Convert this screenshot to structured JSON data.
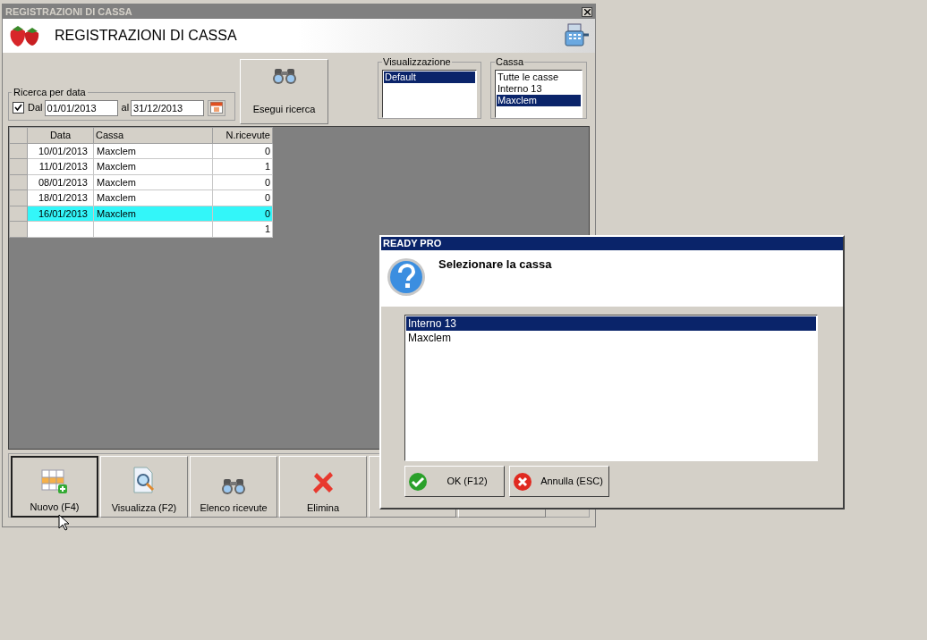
{
  "window": {
    "title": "REGISTRAZIONI DI CASSA",
    "header_title": "REGISTRAZIONI DI CASSA"
  },
  "search": {
    "group_label": "Ricerca per data",
    "checkbox": {
      "label": "Dal",
      "checked": true
    },
    "from": "01/01/2013",
    "to_label": "al",
    "to": "31/12/2013"
  },
  "search_button": "Esegui ricerca",
  "views": {
    "label": "Visualizzazione",
    "items": [
      {
        "label": "Default",
        "selected": true
      }
    ]
  },
  "registers": {
    "label": "Cassa",
    "items": [
      {
        "label": "Tutte le casse",
        "selected": false
      },
      {
        "label": "Interno 13",
        "selected": false
      },
      {
        "label": "Maxclem",
        "selected": true
      }
    ]
  },
  "table": {
    "columns": [
      "Data",
      "Cassa",
      "N.ricevute"
    ],
    "rows": [
      {
        "data": "10/01/2013",
        "cassa": "Maxclem",
        "n_ricevute": "0",
        "selected": false
      },
      {
        "data": "11/01/2013",
        "cassa": "Maxclem",
        "n_ricevute": "1",
        "selected": false
      },
      {
        "data": "08/01/2013",
        "cassa": "Maxclem",
        "n_ricevute": "0",
        "selected": false
      },
      {
        "data": "18/01/2013",
        "cassa": "Maxclem",
        "n_ricevute": "0",
        "selected": false
      },
      {
        "data": "16/01/2013",
        "cassa": "Maxclem",
        "n_ricevute": "0",
        "selected": true
      },
      {
        "n_ricevute": "1",
        "selected": false
      }
    ]
  },
  "buttons": [
    {
      "label": "Nuovo (F4)",
      "focused": true
    },
    {
      "label": "Visualizza (F2)",
      "focused": false
    },
    {
      "label": "Elenco ricevute",
      "focused": false
    },
    {
      "label": "Elimina",
      "focused": false
    },
    {
      "focused": false
    },
    {
      "focused": false
    }
  ],
  "dialog": {
    "title": "READY PRO",
    "message": "Selezionare la cassa",
    "items": [
      {
        "label": "Interno 13",
        "selected": true
      },
      {
        "label": "Maxclem",
        "selected": false
      }
    ],
    "buttons": [
      {
        "label": "OK (F12)",
        "kind": "ok"
      },
      {
        "label": "Annulla (ESC)",
        "kind": "cancel"
      }
    ]
  }
}
